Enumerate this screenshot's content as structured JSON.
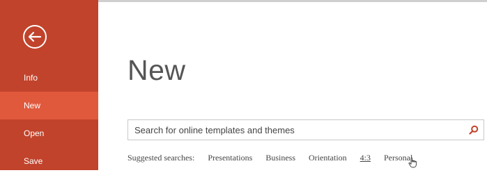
{
  "colors": {
    "sidebar": "#c1432b",
    "selected": "#e0593d",
    "search_icon": "#c1432b"
  },
  "sidebar": {
    "back_icon": "back-arrow-icon",
    "items": [
      {
        "label": "Info",
        "selected": false
      },
      {
        "label": "New",
        "selected": true
      },
      {
        "label": "Open",
        "selected": false
      },
      {
        "label": "Save",
        "selected": false
      }
    ]
  },
  "main": {
    "title": "New",
    "search": {
      "placeholder": "Search for online templates and themes",
      "icon": "search-icon"
    },
    "suggested": {
      "label": "Suggested searches:",
      "items": [
        "Presentations",
        "Business",
        "Orientation",
        "4:3",
        "Personal"
      ]
    }
  }
}
